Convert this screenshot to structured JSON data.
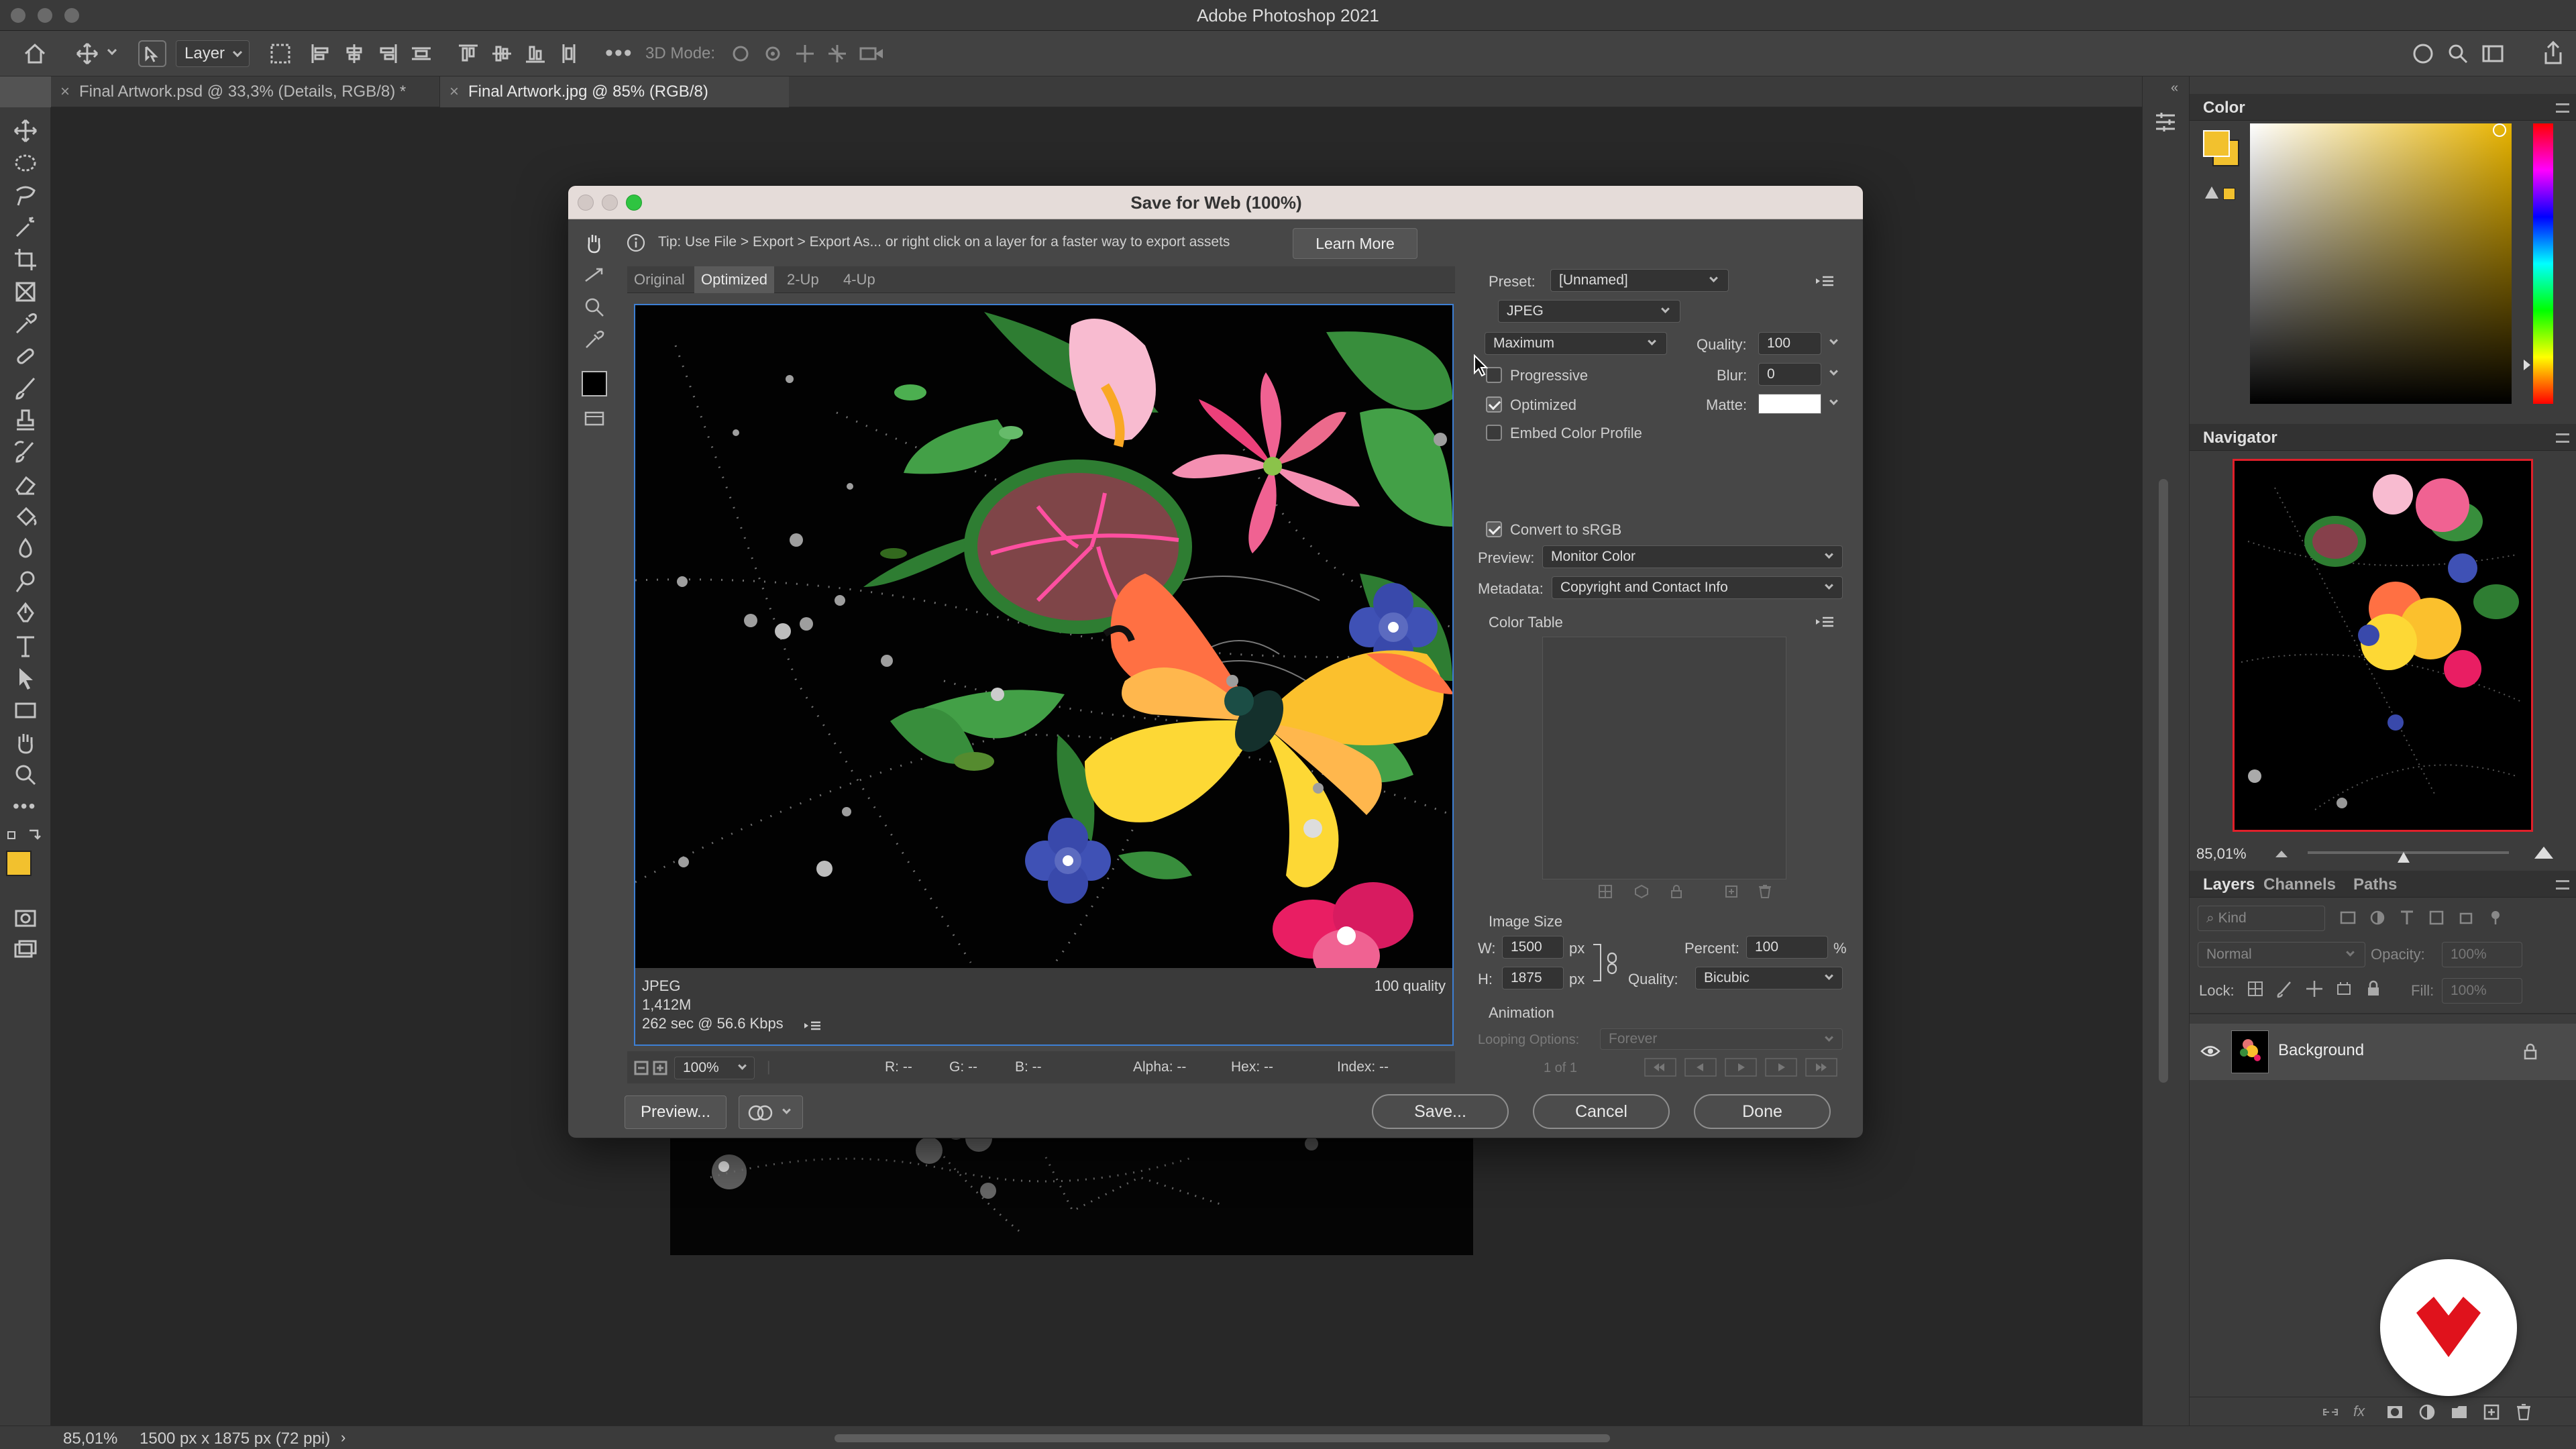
{
  "app": {
    "title": "Adobe Photoshop 2021"
  },
  "options_bar": {
    "layer_select": "Layer",
    "mode_3d": "3D Mode:"
  },
  "tabs": [
    {
      "label": "Final Artwork.psd @ 33,3% (Details, RGB/8) *",
      "active": false
    },
    {
      "label": "Final Artwork.jpg @ 85% (RGB/8)",
      "active": true
    }
  ],
  "status": {
    "zoom": "85,01%",
    "doc_info": "1500 px x 1875 px (72 ppi)"
  },
  "dialog": {
    "title": "Save for Web (100%)",
    "tip": "Tip: Use File > Export > Export As...  or right click on a layer for a faster way to export assets",
    "learn_more": "Learn More",
    "view_tabs": [
      "Original",
      "Optimized",
      "2-Up",
      "4-Up"
    ],
    "selected_view": "Optimized",
    "preview_info": {
      "format": "JPEG",
      "size": "1,412M",
      "time": "262 sec @ 56.6 Kbps",
      "quality_label": "100 quality"
    },
    "bottom_bar": {
      "zoom": "100%",
      "r": "R: --",
      "g": "G: --",
      "b": "B: --",
      "alpha": "Alpha: --",
      "hex": "Hex: --",
      "index": "Index: --"
    },
    "settings": {
      "preset_label": "Preset:",
      "preset": "[Unnamed]",
      "format": "JPEG",
      "quality_level": "Maximum",
      "quality_label": "Quality:",
      "quality": "100",
      "blur_label": "Blur:",
      "blur": "0",
      "matte_label": "Matte:",
      "progressive": {
        "label": "Progressive",
        "checked": false
      },
      "optimized": {
        "label": "Optimized",
        "checked": true
      },
      "embed_profile": {
        "label": "Embed Color Profile",
        "checked": false
      },
      "convert_srgb": {
        "label": "Convert to sRGB",
        "checked": true
      },
      "preview_label": "Preview:",
      "preview": "Monitor Color",
      "metadata_label": "Metadata:",
      "metadata": "Copyright and Contact Info",
      "color_table_label": "Color Table",
      "image_size_label": "Image Size",
      "w_label": "W:",
      "width": "1500",
      "h_label": "H:",
      "height": "1875",
      "px": "px",
      "percent_label": "Percent:",
      "percent": "100",
      "pct": "%",
      "resample_label": "Quality:",
      "resample": "Bicubic",
      "animation_label": "Animation",
      "looping_label": "Looping Options:",
      "looping": "Forever",
      "frame_counter": "1 of 1"
    },
    "buttons": {
      "preview": "Preview...",
      "save": "Save...",
      "cancel": "Cancel",
      "done": "Done"
    }
  },
  "panels": {
    "color": {
      "title": "Color",
      "foreground": "#f2c12e",
      "background": "#f2c12e"
    },
    "navigator": {
      "title": "Navigator",
      "zoom": "85,01%"
    },
    "layers": {
      "tabs": [
        "Layers",
        "Channels",
        "Paths"
      ],
      "kind": "Kind",
      "blend_mode": "Normal",
      "opacity_label": "Opacity:",
      "opacity": "100%",
      "lock_label": "Lock:",
      "fill_label": "Fill:",
      "fill": "100%",
      "layer_name": "Background"
    }
  },
  "colors": {
    "accent_blue": "#3d7fd4",
    "logo_red": "#e0121c",
    "swatch_yellow": "#f2c12e"
  }
}
